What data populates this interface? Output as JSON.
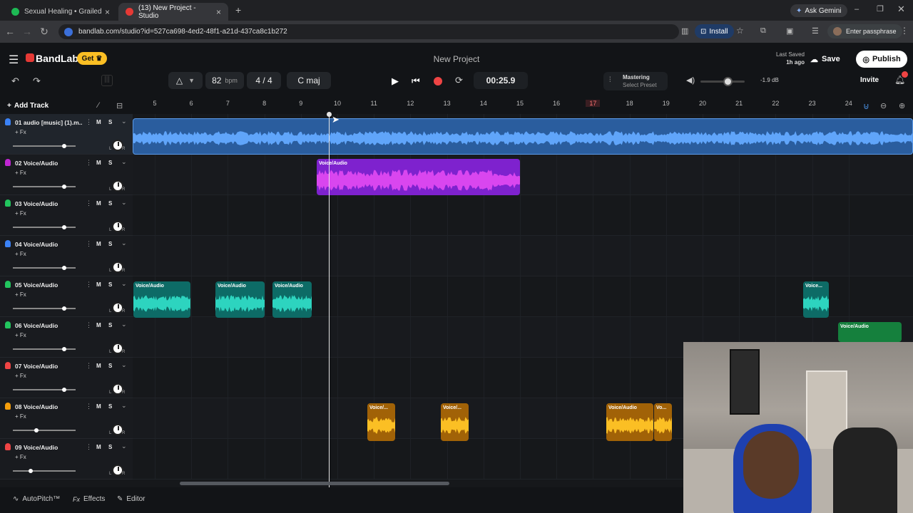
{
  "browser": {
    "tabs": [
      {
        "title": "Sexual Healing • Grailed",
        "color": "#1db954"
      },
      {
        "title": "(13) New Project - Studio",
        "color": "#e53935"
      }
    ],
    "url": "bandlab.com/studio?id=527ca698-4ed2-48f1-a21d-437ca8c1b272",
    "ask_gemini": "Ask Gemini",
    "install": "Install",
    "passphrase": "Enter passphrase"
  },
  "app": {
    "brand": "BandLab",
    "get_label": "Get",
    "project_title": "New Project",
    "last_saved_label": "Last Saved",
    "last_saved_value": "1h ago",
    "save_label": "Save",
    "publish_label": "Publish",
    "invite_label": "Invite",
    "bpm_value": "82",
    "bpm_unit": "bpm",
    "time_sig": "4 / 4",
    "key": "C maj",
    "time": "00:25.9",
    "mastering_label": "Mastering",
    "mastering_preset": "Select Preset",
    "volume_db": "-1.9 dB",
    "add_track_label": "Add Track",
    "accent": "#fbbf24"
  },
  "ruler": {
    "bars": [
      "5",
      "6",
      "7",
      "8",
      "9",
      "10",
      "11",
      "12",
      "13",
      "14",
      "15",
      "16",
      "17",
      "18",
      "19",
      "20",
      "21",
      "22",
      "23",
      "24"
    ],
    "highlight_bar": "17"
  },
  "tracks": [
    {
      "name": "01 audio [music] (1).m...",
      "fx": "+ Fx",
      "color": "#3b82f6",
      "volume": 0.8,
      "m": "M",
      "s": "S"
    },
    {
      "name": "02 Voice/Audio",
      "fx": "+ Fx",
      "color": "#c026d3",
      "volume": 0.8,
      "m": "M",
      "s": "S"
    },
    {
      "name": "03 Voice/Audio",
      "fx": "+ Fx",
      "color": "#22c55e",
      "volume": 0.8,
      "m": "M",
      "s": "S"
    },
    {
      "name": "04 Voice/Audio",
      "fx": "+ Fx",
      "color": "#3b82f6",
      "volume": 0.8,
      "m": "M",
      "s": "S"
    },
    {
      "name": "05 Voice/Audio",
      "fx": "+ Fx",
      "color": "#22c55e",
      "volume": 0.8,
      "m": "M",
      "s": "S"
    },
    {
      "name": "06 Voice/Audio",
      "fx": "+ Fx",
      "color": "#22c55e",
      "volume": 0.8,
      "m": "M",
      "s": "S"
    },
    {
      "name": "07 Voice/Audio",
      "fx": "+ Fx",
      "color": "#ef4444",
      "volume": 0.8,
      "m": "M",
      "s": "S"
    },
    {
      "name": "08 Voice/Audio",
      "fx": "+ Fx",
      "color": "#f59e0b",
      "volume": 0.35,
      "m": "M",
      "s": "S"
    },
    {
      "name": "09 Voice/Audio",
      "fx": "+ Fx",
      "color": "#ef4444",
      "volume": 0.25,
      "m": "M",
      "s": "S"
    }
  ],
  "clips": {
    "c2": "Voice/Audio",
    "c5a": "Voice/Audio",
    "c5b": "Voice/Audio",
    "c5c": "Voice/Audio",
    "c5d": "Voice...",
    "c6": "Voice/Audio",
    "c8a": "Voice/...",
    "c8b": "Voice/...",
    "c8c": "Voice/Audio",
    "c8d": "Vo..."
  },
  "bottom": {
    "autopitch": "AutoPitch™",
    "effects": "Effects",
    "editor": "Editor"
  },
  "knob_l": "L",
  "knob_r": "R"
}
